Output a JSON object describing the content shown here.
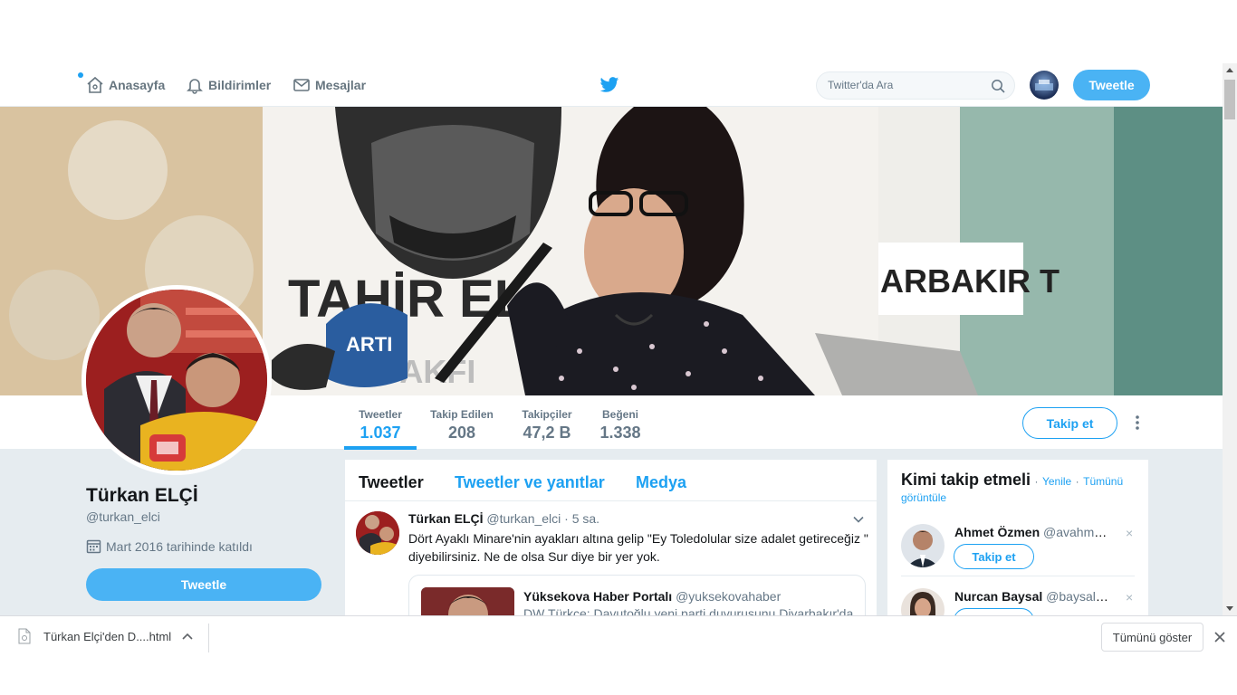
{
  "nav": {
    "home": "Anasayfa",
    "notifications": "Bildirimler",
    "messages": "Mesajlar",
    "search_placeholder": "Twitter'da Ara",
    "tweet_button": "Tweetle"
  },
  "profile": {
    "name": "Türkan ELÇİ",
    "handle": "@turkan_elci",
    "joined": "Mart 2016 tarihinde katıldı",
    "tweet_button": "Tweetle",
    "follow_button": "Takip et"
  },
  "stats": [
    {
      "label": "Tweetler",
      "value": "1.037"
    },
    {
      "label": "Takip Edilen",
      "value": "208"
    },
    {
      "label": "Takipçiler",
      "value": "47,2 B"
    },
    {
      "label": "Beğeni",
      "value": "1.338"
    }
  ],
  "timeline": {
    "tabs": [
      "Tweetler",
      "Tweetler ve yanıtlar",
      "Medya"
    ],
    "tweet": {
      "name": "Türkan ELÇİ",
      "handle": "@turkan_elci",
      "time": "· 5 sa.",
      "text": "Dört Ayaklı Minare'nin ayakları altına gelip \"Ey Toledolular size adalet getireceğiz \" diyebilirsiniz. Ne de olsa Sur diye bir yer yok.",
      "card": {
        "source_name": "Yüksekova Haber Portalı",
        "source_handle": "@yuksekovahaber",
        "text": "DW Türkçe: Davutoğlu yeni parti duyurusunu Diyarbakır'da"
      }
    }
  },
  "who_to_follow": {
    "title": "Kimi takip etmeli",
    "refresh": "Yenile",
    "separator": "·",
    "view_all": "Tümünü görüntüle",
    "follow_label": "Takip et",
    "close": "×",
    "users": [
      {
        "name": "Ahmet Özmen",
        "handle": "@avahmet..."
      },
      {
        "name": "Nurcan Baysal",
        "handle": "@baysal_n..."
      }
    ]
  },
  "banner": {
    "sign_text": "TAHİR EL",
    "sign_sub": "VAKFI",
    "side_text": "ARBAKIR T",
    "mic_label": "ARTI"
  },
  "download_bar": {
    "filename": "Türkan Elçi'den D....html",
    "show_all": "Tümünü göster"
  },
  "colors": {
    "accent": "#1da1f2",
    "button_fill": "#4ab3f4",
    "page_bg": "#e6ecf0"
  }
}
